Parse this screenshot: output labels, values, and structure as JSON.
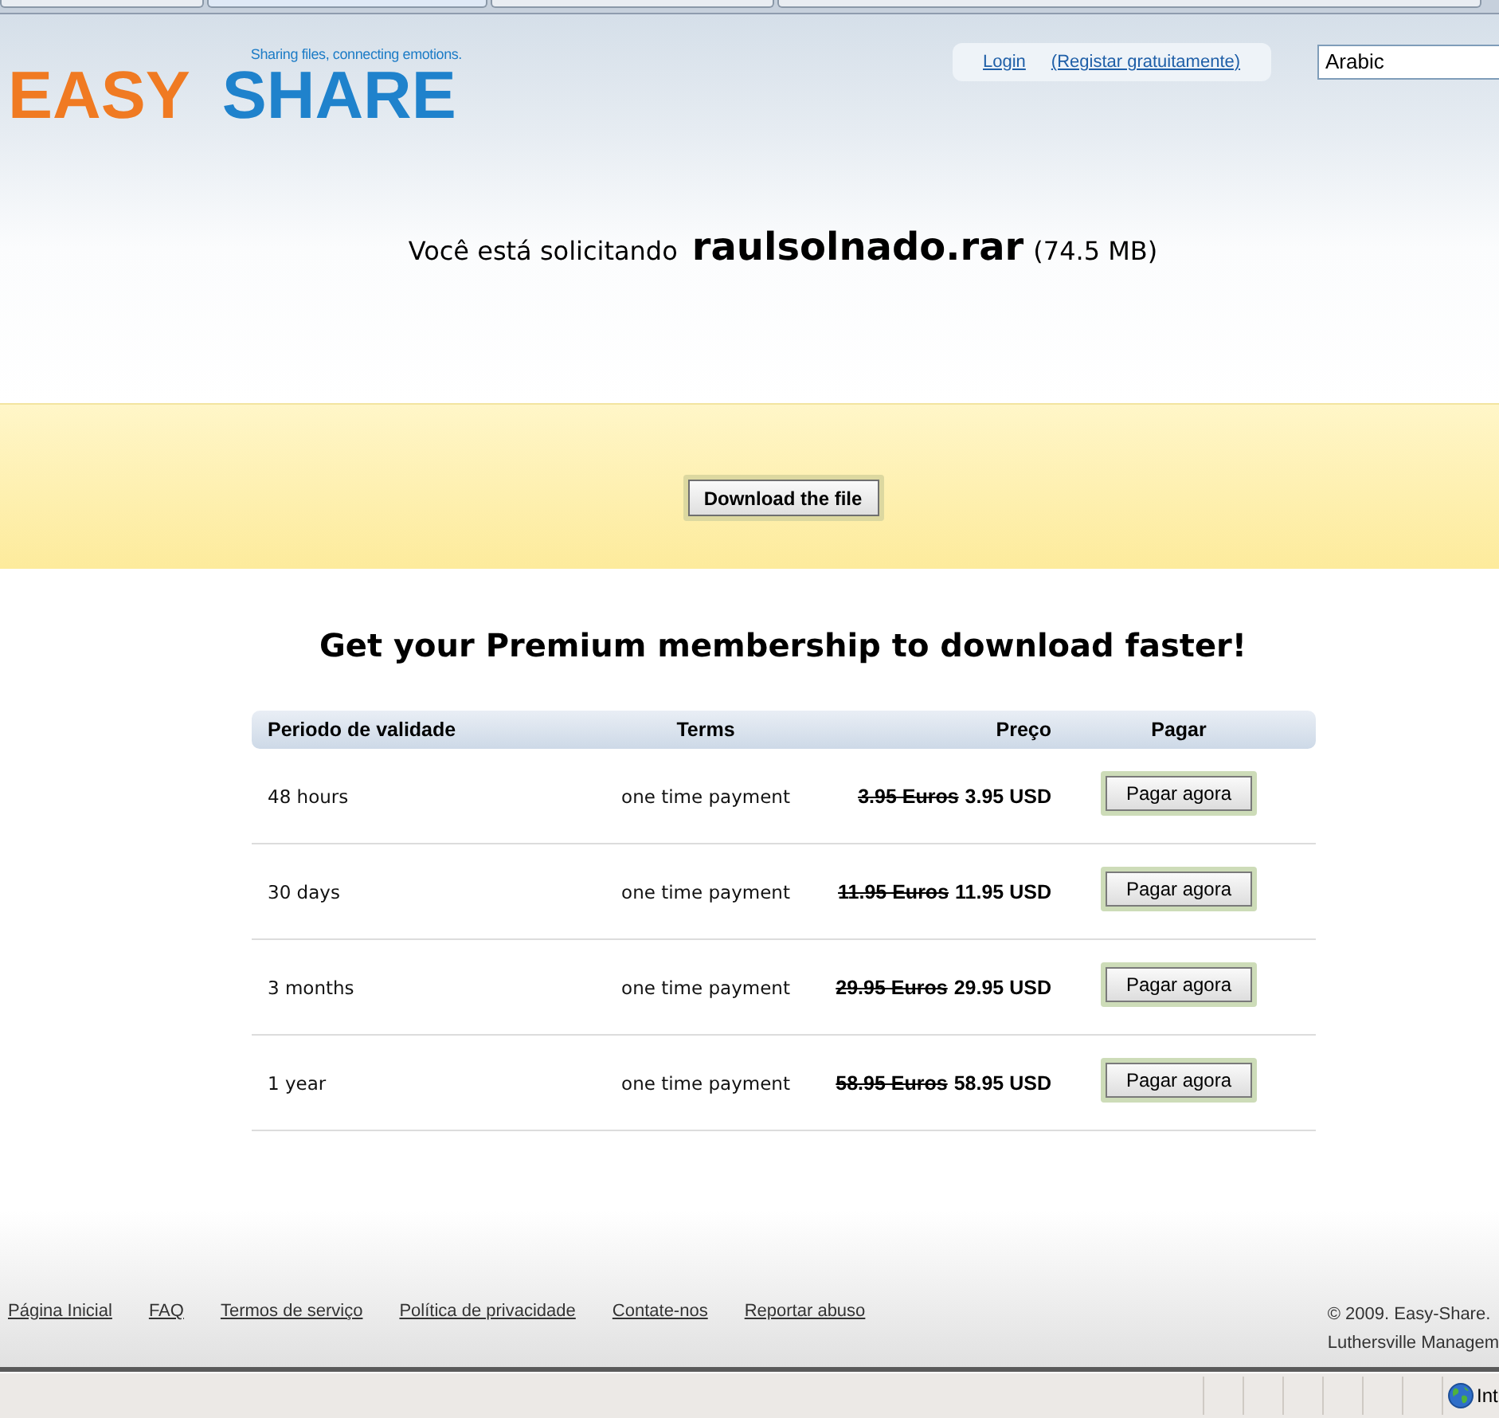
{
  "header": {
    "logo": {
      "tagline": "Sharing files, connecting emotions.",
      "word_1": "EASY",
      "word_2": "SHARE"
    },
    "login_link": "Login",
    "register_link": "(Registar gratuitamente)",
    "language_select": {
      "value": "Arabic"
    }
  },
  "request": {
    "prefix": "Você está solicitando",
    "file_name": "raulsolnado.rar",
    "file_size": "(74.5 MB)"
  },
  "download_button": "Download the file",
  "premium": {
    "heading": "Get your Premium membership to download faster!",
    "table": {
      "columns": [
        "Periodo de validade",
        "Terms",
        "Preço",
        "Pagar"
      ],
      "rows": [
        {
          "period": "48 hours",
          "terms": "one time payment",
          "old_price": "3.95 Euros",
          "price": "3.95 USD",
          "button": "Pagar agora"
        },
        {
          "period": "30 days",
          "terms": "one time payment",
          "old_price": "11.95 Euros",
          "price": "11.95 USD",
          "button": "Pagar agora"
        },
        {
          "period": "3 months",
          "terms": "one time payment",
          "old_price": "29.95 Euros",
          "price": "29.95 USD",
          "button": "Pagar agora"
        },
        {
          "period": "1 year",
          "terms": "one time payment",
          "old_price": "58.95 Euros",
          "price": "58.95 USD",
          "button": "Pagar agora"
        }
      ]
    }
  },
  "footer": {
    "links": [
      "Página Inicial",
      "FAQ",
      "Termos de serviço",
      "Política de privacidade",
      "Contate-nos",
      "Reportar abuso"
    ],
    "copyright": [
      "© 2009. Easy-Share.",
      "Luthersville Managem"
    ]
  },
  "status_bar": {
    "zone": "Int"
  }
}
